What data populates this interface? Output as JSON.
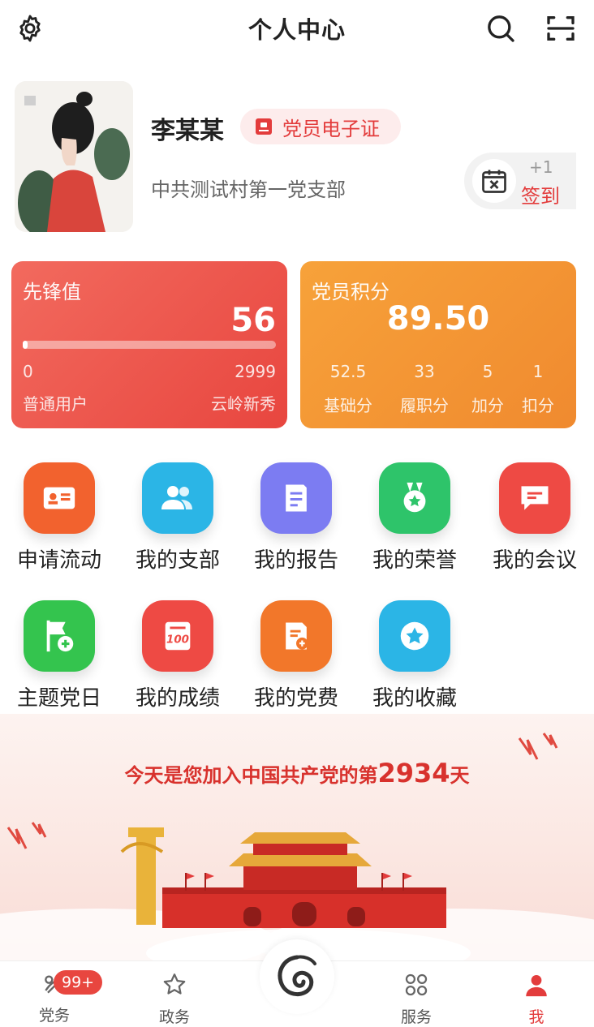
{
  "header": {
    "title": "个人中心"
  },
  "profile": {
    "name": "李某某",
    "badge_label": "党员电子证",
    "branch": "中共测试村第一党支部",
    "checkin_plus": "+1",
    "checkin_label": "签到"
  },
  "vanguard": {
    "title": "先锋值",
    "value": "56",
    "min": "0",
    "max": "2999",
    "progress": 0.019,
    "level_left": "普通用户",
    "level_right": "云岭新秀"
  },
  "points": {
    "title": "党员积分",
    "value": "89.50",
    "items": [
      {
        "value": "52.5",
        "label": "基础分"
      },
      {
        "value": "33",
        "label": "履职分"
      },
      {
        "value": "5",
        "label": "加分"
      },
      {
        "value": "1",
        "label": "扣分"
      }
    ]
  },
  "grid": [
    {
      "label": "申请流动",
      "icon": "id-card-icon",
      "color": "#f2622e"
    },
    {
      "label": "我的支部",
      "icon": "people-icon",
      "color": "#2bb5e6"
    },
    {
      "label": "我的报告",
      "icon": "document-icon",
      "color": "#7c7cf2"
    },
    {
      "label": "我的荣誉",
      "icon": "medal-icon",
      "color": "#2ec46a"
    },
    {
      "label": "我的会议",
      "icon": "chat-icon",
      "color": "#ee4a44"
    },
    {
      "label": "主题党日",
      "icon": "flag-plus-icon",
      "color": "#34c44e"
    },
    {
      "label": "我的成绩",
      "icon": "score-100-icon",
      "color": "#ee4a44"
    },
    {
      "label": "我的党费",
      "icon": "fee-doc-icon",
      "color": "#f2772a"
    },
    {
      "label": "我的收藏",
      "icon": "star-circle-icon",
      "color": "#2bb5e6"
    }
  ],
  "banner": {
    "text_before": "今天是您加入中国共产党的第",
    "days": "2934",
    "text_after": "天"
  },
  "tabs": [
    {
      "label": "党务",
      "icon": "party-icon"
    },
    {
      "label": "政务",
      "icon": "star-outline-icon"
    },
    {
      "label": "服务",
      "icon": "grid-services-icon"
    },
    {
      "label": "我",
      "icon": "person-icon"
    }
  ],
  "notice_badge": "99+",
  "colors": {
    "accent": "#e33c3c",
    "orange": "#f08a2f"
  }
}
